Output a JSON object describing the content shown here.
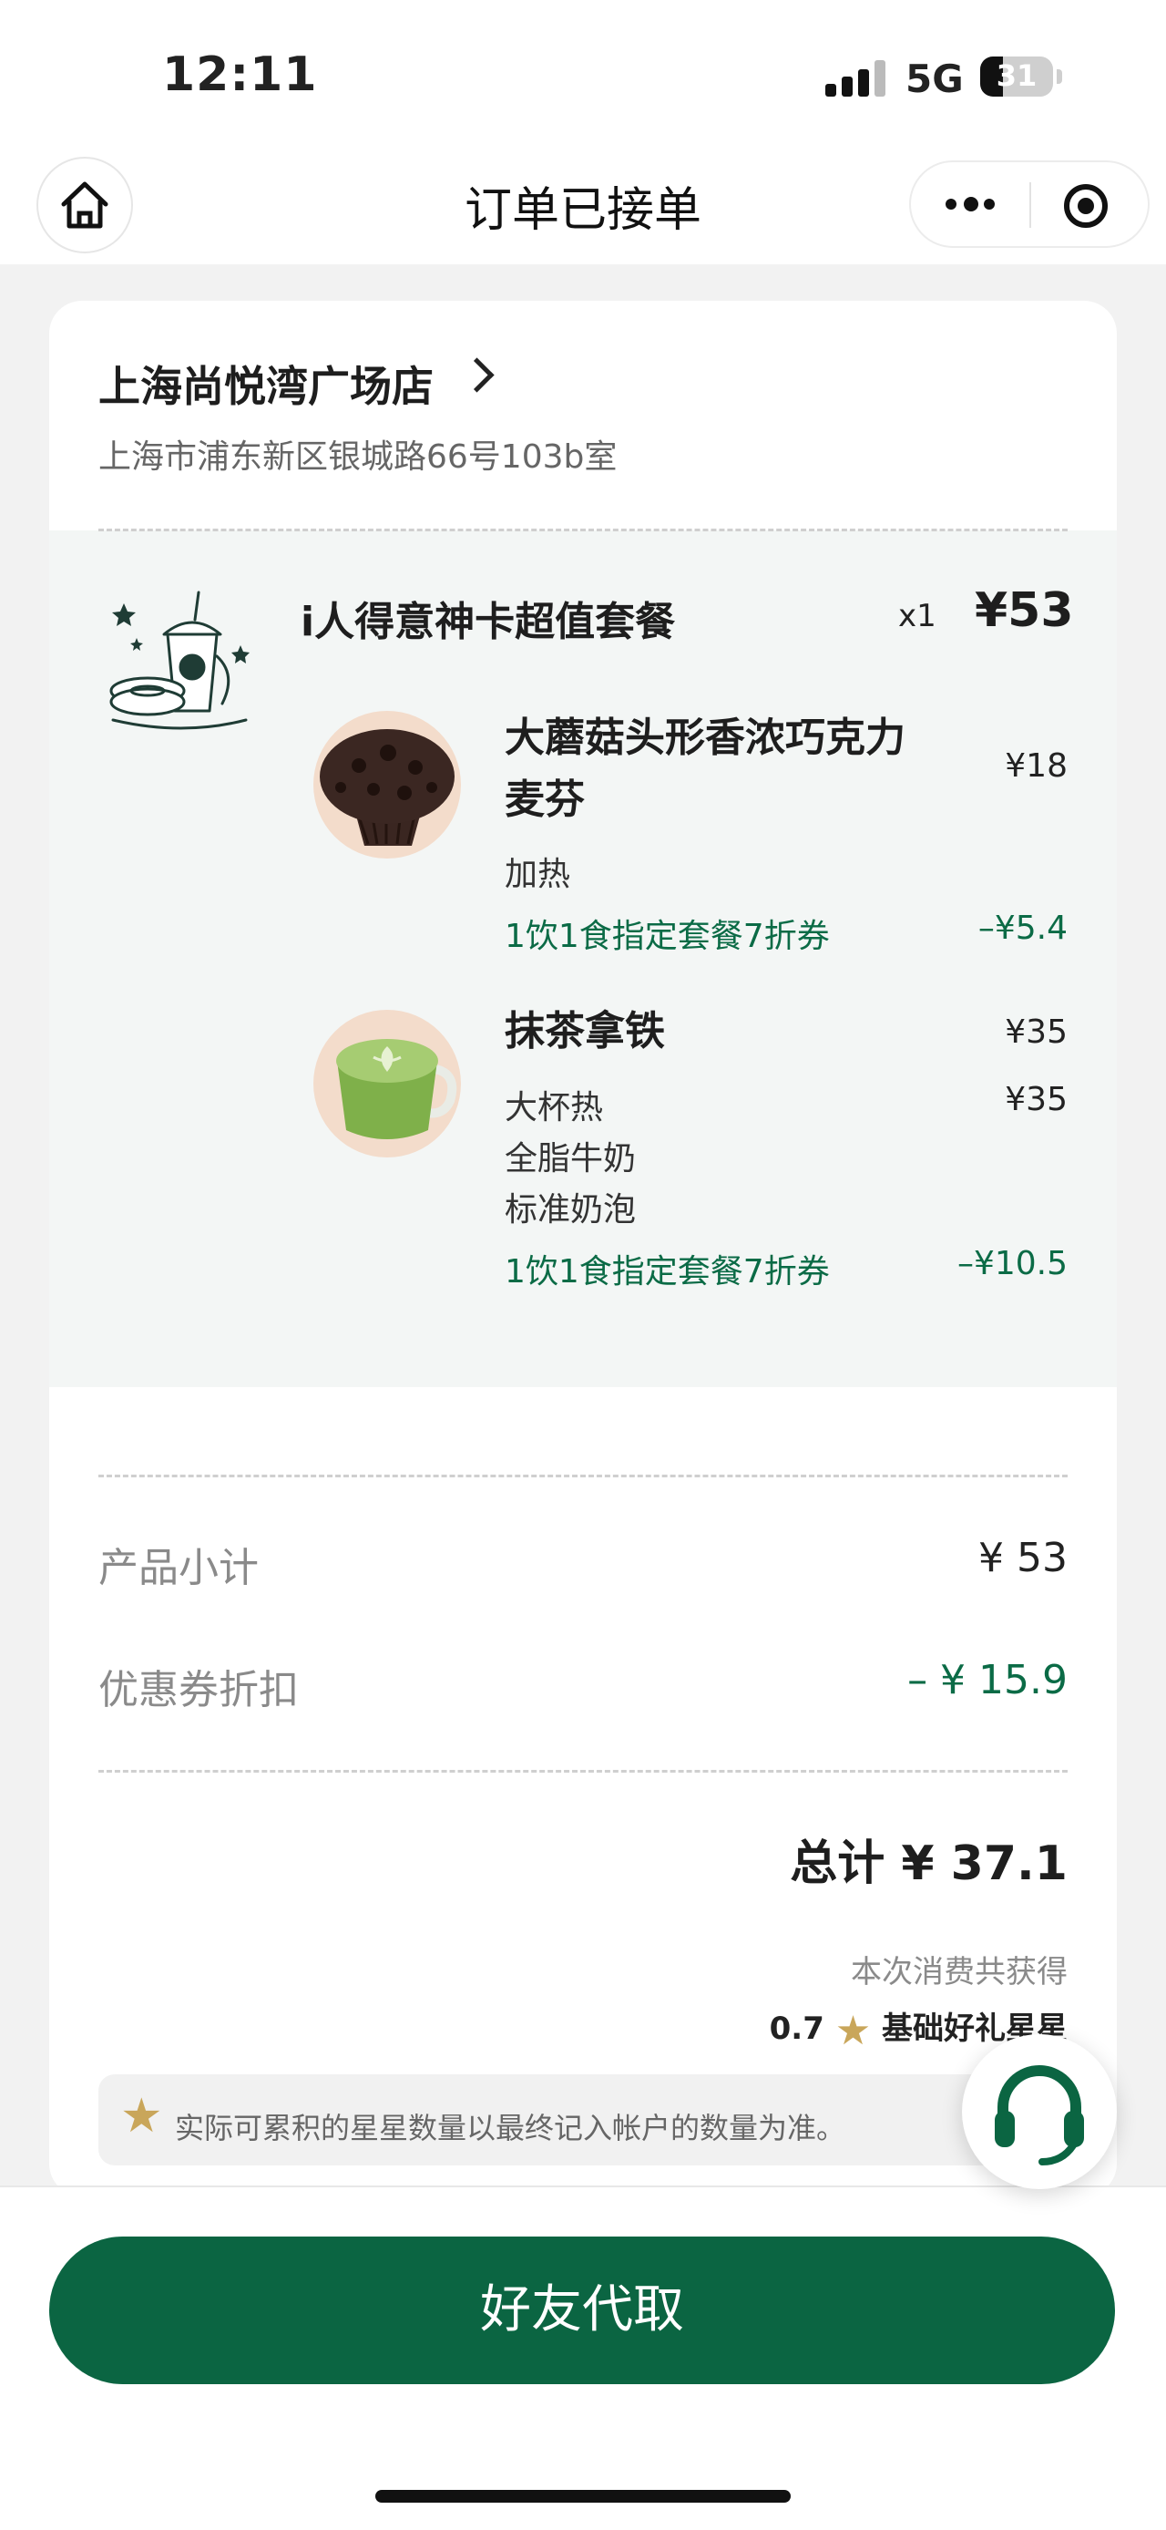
{
  "status_bar": {
    "time": "12:11",
    "network": "5G",
    "battery": "31",
    "battery_fraction": 0.31
  },
  "nav": {
    "title": "订单已接单",
    "home_icon": "home-icon",
    "more_icon": "more-dots-icon",
    "close_icon": "target-circle-icon"
  },
  "store": {
    "name": "上海尚悦湾广场店",
    "address": "上海市浦东新区银城路66号103b室"
  },
  "combo": {
    "name": "i人得意神卡超值套餐",
    "quantity": "x1",
    "price": "¥53"
  },
  "items": [
    {
      "name_line1": "大蘑菇头形香浓巧克力",
      "name_line2": "麦芬",
      "price": "¥18",
      "options": [
        "加热"
      ],
      "coupon": "1饮1食指定套餐7折券",
      "coupon_amount": "–¥5.4"
    },
    {
      "name_line1": "抹茶拿铁",
      "price": "¥35",
      "options": [
        "大杯热",
        "全脂牛奶",
        "标准奶泡"
      ],
      "option_price": "¥35",
      "coupon": "1饮1食指定套餐7折券",
      "coupon_amount": "–¥10.5"
    }
  ],
  "summary": {
    "subtotal_label": "产品小计",
    "subtotal_value": "¥ 53",
    "discount_label": "优惠券折扣",
    "discount_value": "– ¥ 15.9",
    "total": "总计 ¥ 37.1",
    "earn_label": "本次消费共获得",
    "earn_amount": "0.7",
    "earn_type": "基础好礼星星"
  },
  "notice": "实际可累积的星星数量以最终记入帐户的数量为准。",
  "cta": {
    "label": "好友代取"
  },
  "colors": {
    "brand_green": "#0b6542",
    "coupon_green": "#0b6b46",
    "star_gold": "#c9a65a"
  }
}
